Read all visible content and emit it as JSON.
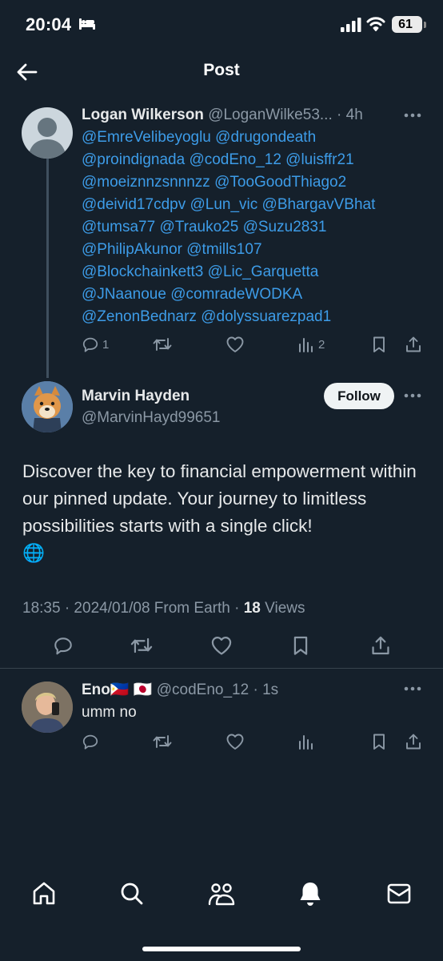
{
  "status_bar": {
    "time": "20:04",
    "battery": "61"
  },
  "header": {
    "title": "Post"
  },
  "reply_tweet": {
    "display_name": "Logan Wilkerson",
    "handle": "@LoganWilke53...",
    "time": "· 4h",
    "mention_lines": [
      [
        "@EmreVelibeyoglu",
        "@drugondeath"
      ],
      [
        "@proindignada",
        "@codEno_12",
        "@luisffr21"
      ],
      [
        "@moeiznnzsnnnzz",
        "@TooGoodThiago2"
      ],
      [
        "@deivid17cdpv",
        "@Lun_vic",
        "@BhargavVBhat"
      ],
      [
        "@tumsa77",
        "@Trauko25",
        "@Suzu2831"
      ],
      [
        "@PhilipAkunor",
        "@tmills107"
      ],
      [
        "@Blockchainkett3",
        "@Lic_Garquetta"
      ],
      [
        "@JNaanoue",
        "@comradeWODKA"
      ],
      [
        "@ZenonBednarz",
        "@dolyssuarezpad1"
      ]
    ],
    "reply_count": "1",
    "views_count": "2"
  },
  "main_post": {
    "display_name": "Marvin Hayden",
    "handle": "@MarvinHayd99651",
    "follow_label": "Follow",
    "text": "Discover the key to financial empowerment within our pinned update. Your journey to limitless possibilities starts with a single click!",
    "emoji": "🌐",
    "meta_prefix": "18:35 · 2024/01/08 From Earth · ",
    "views_number": "18",
    "views_label": " Views"
  },
  "comment": {
    "display_name": "Eno",
    "flags": "🇵🇭 🇯🇵",
    "handle": "@codEno_12",
    "time": "· 1s",
    "text": "umm no"
  },
  "colors": {
    "background": "#15202b",
    "mention": "#3d9ce8",
    "secondary_text": "#8b98a5"
  },
  "icons": {
    "header": [
      "back-arrow-icon"
    ],
    "actions": [
      "reply-icon",
      "retweet-icon",
      "like-icon",
      "views-icon",
      "bookmark-icon",
      "share-icon"
    ],
    "nav": [
      "home-icon",
      "search-icon",
      "communities-icon",
      "notifications-icon",
      "messages-icon"
    ]
  }
}
